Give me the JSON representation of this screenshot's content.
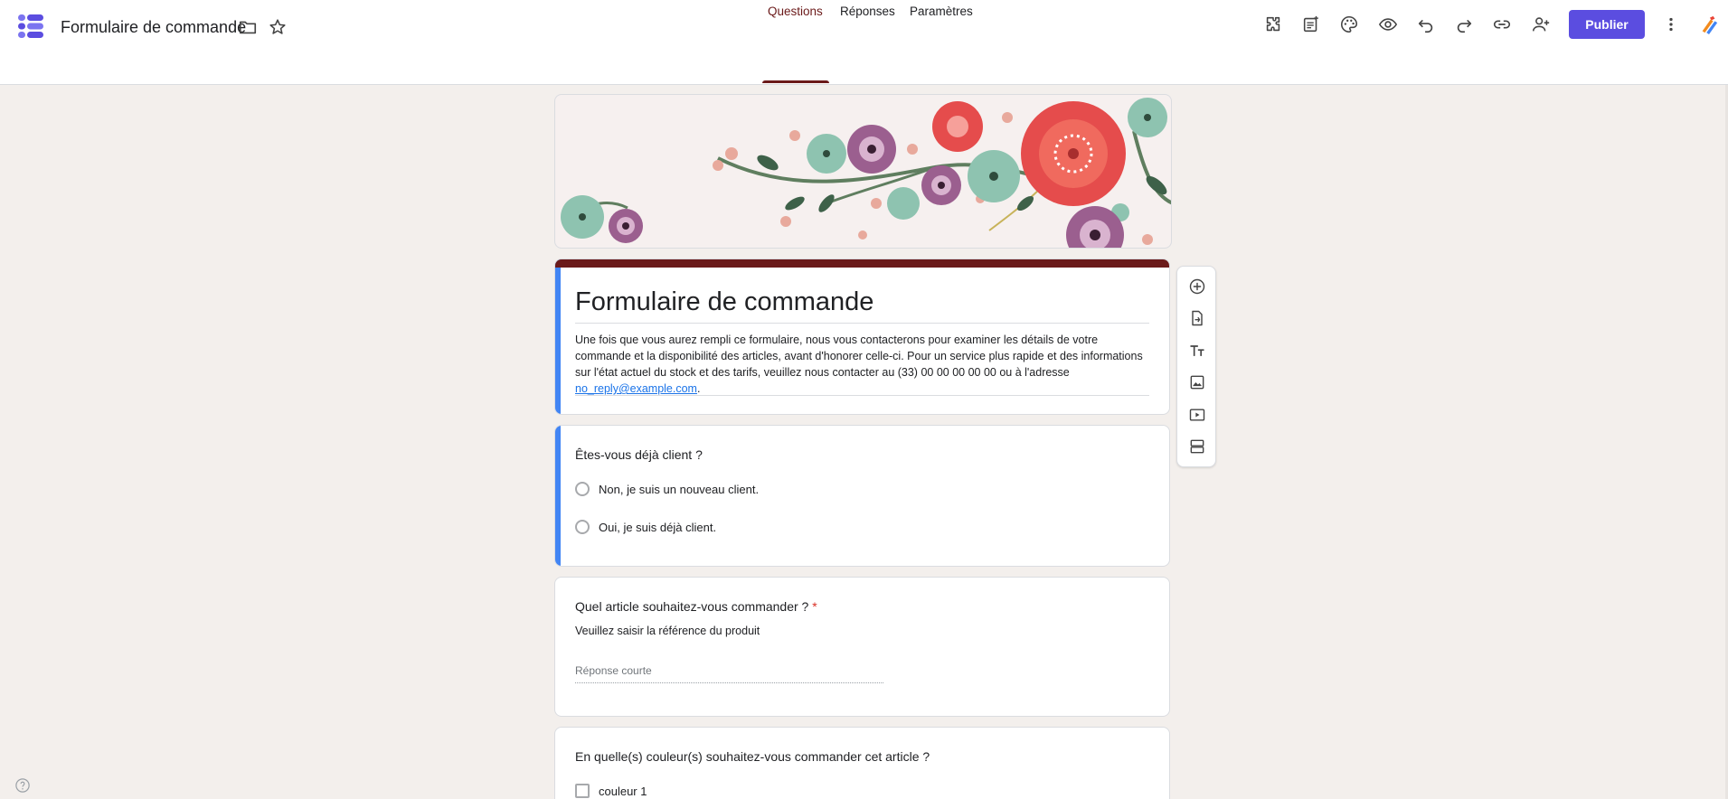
{
  "header": {
    "doc_title": "Formulaire de commande",
    "publish_label": "Publier",
    "accent_color": "#5b4de0"
  },
  "tabs": [
    {
      "label": "Questions",
      "active": true
    },
    {
      "label": "Réponses",
      "active": false
    },
    {
      "label": "Paramètres",
      "active": false
    }
  ],
  "form": {
    "title": "Formulaire de commande",
    "description_text": "Une fois que vous aurez rempli ce formulaire, nous vous contacterons pour examiner les détails de votre commande et la disponibilité des articles, avant d'honorer celle-ci. Pour un service plus rapide et des informations sur l'état actuel du stock et des tarifs, veuillez nous contacter au (33) 00 00 00 00 00 ou à l'adresse ",
    "description_email": "no_reply@example.com",
    "description_end": ".",
    "theme_color": "#6b1a1a"
  },
  "questions": [
    {
      "title": "Êtes-vous déjà client ?",
      "options": [
        "Non, je suis un nouveau client.",
        "Oui, je suis déjà client."
      ]
    },
    {
      "title": "Quel article souhaitez-vous commander ?",
      "required_mark": "*",
      "subtitle": "Veuillez saisir la référence du produit",
      "placeholder": "Réponse courte"
    },
    {
      "title": "En quelle(s) couleur(s) souhaitez-vous commander cet article ?",
      "options": [
        "couleur 1"
      ]
    }
  ],
  "icons": {
    "header": [
      "addons-icon",
      "sheet-link-icon",
      "palette-icon",
      "preview-eye-icon",
      "undo-icon",
      "redo-icon",
      "link-icon",
      "add-collaborator-icon",
      "more-vert-icon"
    ],
    "side_toolbar": [
      "add-question-icon",
      "import-questions-icon",
      "add-title-icon",
      "add-image-icon",
      "add-video-icon",
      "add-section-icon"
    ]
  }
}
